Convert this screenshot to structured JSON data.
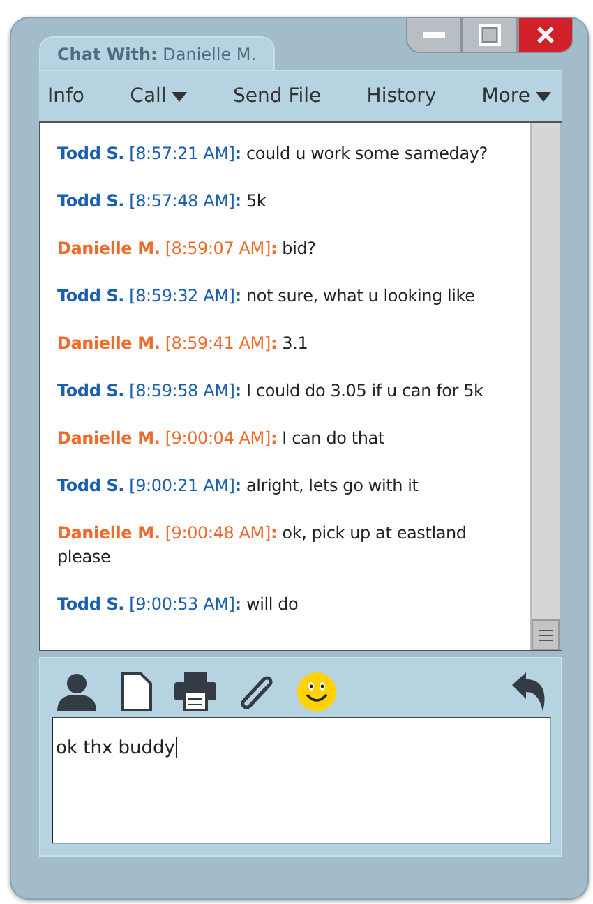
{
  "window": {
    "tab_label": "Chat With:",
    "tab_name": "Danielle M."
  },
  "menu": [
    {
      "label": "Info",
      "dropdown": false
    },
    {
      "label": "Call",
      "dropdown": true
    },
    {
      "label": "Send File",
      "dropdown": false
    },
    {
      "label": "History",
      "dropdown": false
    },
    {
      "label": "More",
      "dropdown": true
    }
  ],
  "messages": [
    {
      "sender": "Todd S.",
      "time": "[8:57:21 AM]",
      "separator": ":",
      "text": "could u work some sameday?",
      "color": "#1a5fb0"
    },
    {
      "sender": "Todd S.",
      "time": "[8:57:48 AM]",
      "separator": ":",
      "text": "5k",
      "color": "#1a5fb0"
    },
    {
      "sender": "Danielle M.",
      "time": "[8:59:07 AM]",
      "separator": ":",
      "text": "bid?",
      "color": "#f06a2c"
    },
    {
      "sender": "Todd S.",
      "time": "[8:59:32 AM]",
      "separator": ":",
      "text": "not sure, what u looking like",
      "color": "#1a5fb0"
    },
    {
      "sender": "Danielle M.",
      "time": "[8:59:41 AM]",
      "separator": ":",
      "text": "3.1",
      "color": "#f06a2c"
    },
    {
      "sender": "Todd S.",
      "time": "[8:59:58 AM]",
      "separator": ":",
      "text": "I could do 3.05 if u can for 5k",
      "color": "#1a5fb0"
    },
    {
      "sender": "Danielle M.",
      "time": "[9:00:04 AM]",
      "separator": ":",
      "text": "I can do that",
      "color": "#f06a2c"
    },
    {
      "sender": "Todd S.",
      "time": "[9:00:21 AM]",
      "separator": ":",
      "text": "alright, lets go with it",
      "color": "#1a5fb0"
    },
    {
      "sender": "Danielle M.",
      "time": "[9:00:48 AM]",
      "separator": ":",
      "text": " ok, pick up at eastland please",
      "color": "#f06a2c"
    },
    {
      "sender": "Todd S.",
      "time": "[9:00:53 AM]",
      "separator": ":",
      "text": "will do",
      "color": "#1a5fb0"
    }
  ],
  "composer": {
    "value": "ok thx buddy"
  }
}
